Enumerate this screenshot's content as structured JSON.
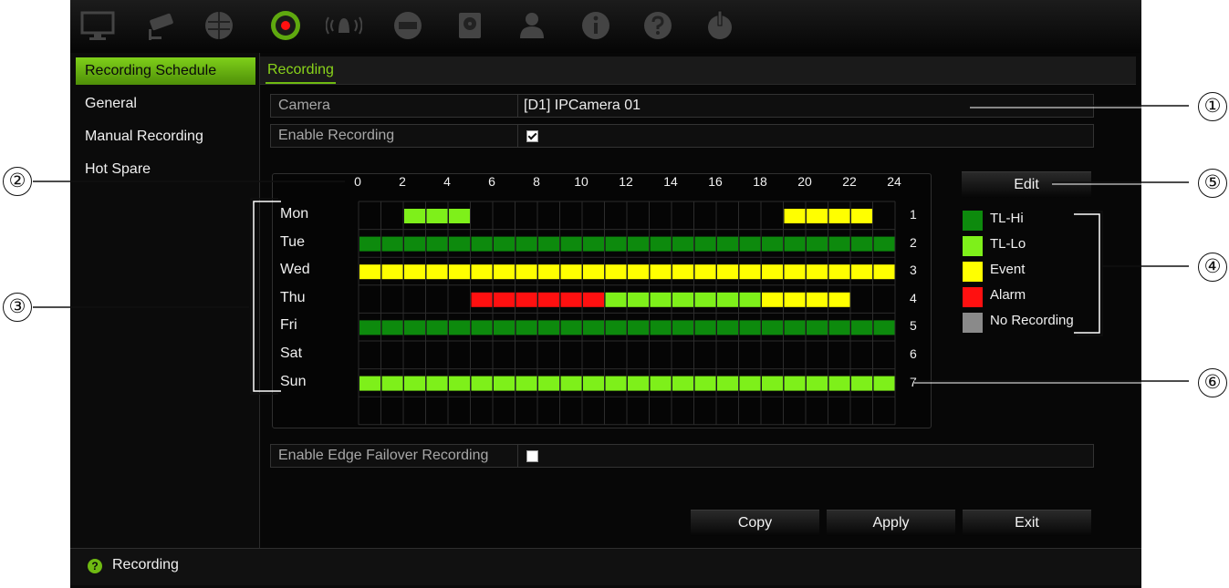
{
  "colors": {
    "tl_hi": "#0d8a0d",
    "tl_lo": "#7ef01a",
    "event": "#ffff00",
    "alarm": "#ff1010",
    "no_recording": "#8a8a8a",
    "accent": "#6fba12"
  },
  "toolbar": {
    "icons": [
      "monitor-icon",
      "camera-icon",
      "network-icon",
      "record-icon",
      "alarm-icon",
      "device-icon",
      "hdd-icon",
      "user-icon",
      "info-icon",
      "help-icon",
      "power-icon"
    ],
    "active": "record-icon"
  },
  "sidebar": {
    "items": [
      {
        "label": "Recording Schedule",
        "active": true
      },
      {
        "label": "General",
        "active": false
      },
      {
        "label": "Manual Recording",
        "active": false
      },
      {
        "label": "Hot Spare",
        "active": false
      }
    ]
  },
  "tab": {
    "label": "Recording"
  },
  "camera": {
    "label": "Camera",
    "value": "[D1] IPCamera 01"
  },
  "enable_recording": {
    "label": "Enable Recording",
    "checked": true
  },
  "schedule": {
    "hours": [
      "0",
      "2",
      "4",
      "6",
      "8",
      "10",
      "12",
      "14",
      "16",
      "18",
      "20",
      "22",
      "24"
    ],
    "days": [
      {
        "name": "Mon",
        "num": "1",
        "cells": [
          "",
          "",
          "",
          "",
          "",
          "",
          "",
          "",
          "",
          "",
          "",
          "",
          "",
          "",
          "",
          "",
          "",
          "",
          "",
          "",
          "",
          "",
          "",
          ""
        ],
        "fill": [
          [
            2,
            5,
            "tl_lo"
          ],
          [
            19,
            23,
            "event"
          ]
        ]
      },
      {
        "name": "Tue",
        "num": "2",
        "fill": [
          [
            0,
            24,
            "tl_hi"
          ]
        ]
      },
      {
        "name": "Wed",
        "num": "3",
        "fill": [
          [
            0,
            24,
            "event"
          ]
        ]
      },
      {
        "name": "Thu",
        "num": "4",
        "fill": [
          [
            5,
            11,
            "alarm"
          ],
          [
            11,
            18,
            "tl_lo"
          ],
          [
            18,
            22,
            "event"
          ]
        ]
      },
      {
        "name": "Fri",
        "num": "5",
        "fill": [
          [
            0,
            24,
            "tl_hi"
          ]
        ]
      },
      {
        "name": "Sat",
        "num": "6",
        "fill": []
      },
      {
        "name": "Sun",
        "num": "7",
        "fill": [
          [
            0,
            24,
            "tl_lo"
          ]
        ]
      }
    ]
  },
  "edit_button": "Edit",
  "legend": [
    {
      "label": "TL-Hi",
      "color": "tl_hi"
    },
    {
      "label": "TL-Lo",
      "color": "tl_lo"
    },
    {
      "label": "Event",
      "color": "event"
    },
    {
      "label": "Alarm",
      "color": "alarm"
    },
    {
      "label": "No Recording",
      "color": "no_recording"
    }
  ],
  "edge_failover": {
    "label": "Enable Edge Failover Recording",
    "checked": false
  },
  "buttons": {
    "copy": "Copy",
    "apply": "Apply",
    "exit": "Exit"
  },
  "status": {
    "text": "Recording"
  },
  "callouts": [
    "①",
    "②",
    "③",
    "④",
    "⑤",
    "⑥"
  ]
}
